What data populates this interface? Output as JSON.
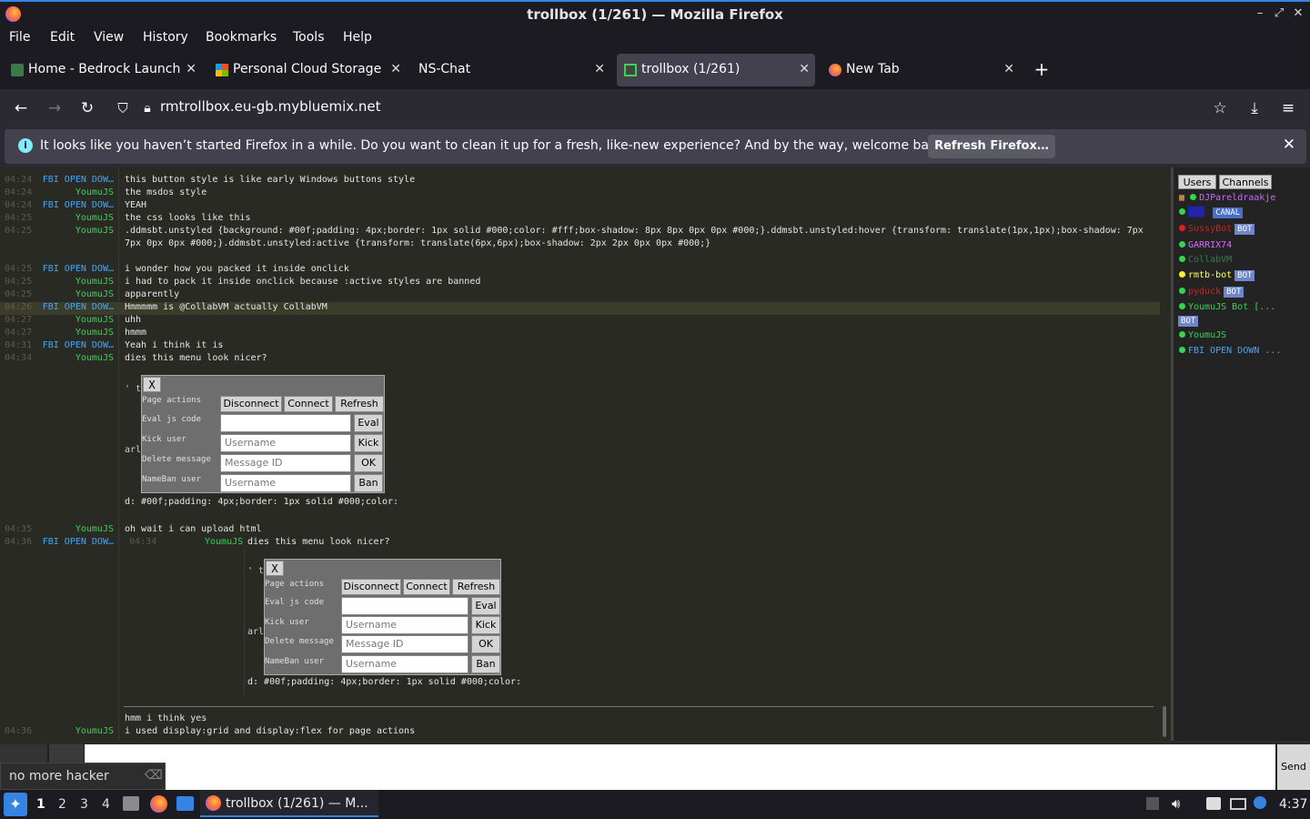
{
  "window": {
    "title": "trollbox (1/261) — Mozilla Firefox"
  },
  "menu": [
    "File",
    "Edit",
    "View",
    "History",
    "Bookmarks",
    "Tools",
    "Help"
  ],
  "tabs": [
    {
      "label": "Home - Bedrock Launche",
      "active": false
    },
    {
      "label": "Personal Cloud Storage -",
      "active": false
    },
    {
      "label": "NS-Chat",
      "active": false
    },
    {
      "label": "trollbox (1/261)",
      "active": true
    },
    {
      "label": "New Tab",
      "active": false
    }
  ],
  "address": {
    "url": "rmtrollbox.eu-gb.mybluemix.net"
  },
  "notification": {
    "message": "It looks like you haven’t started Firefox in a while. Do you want to clean it up for a fresh, like-new experience? And by the way, welcome back!",
    "button": "Refresh Firefox…"
  },
  "chat": {
    "messages": [
      {
        "time": "04:24",
        "user": "FBI OPEN DOW…",
        "text": "this button style is like early Windows buttons style",
        "color": "blue"
      },
      {
        "time": "04:24",
        "user": "YoumuJS",
        "text": "the msdos style",
        "color": "green"
      },
      {
        "time": "04:24",
        "user": "FBI OPEN DOW…",
        "text": "YEAH",
        "color": "blue"
      },
      {
        "time": "04:25",
        "user": "YoumuJS",
        "text": "the css looks like this",
        "color": "green"
      },
      {
        "time": "04:25",
        "user": "YoumuJS",
        "text": ".ddmsbt.unstyled {background: #00f;padding: 4px;border: 1px solid #000;color: #fff;box-shadow: 8px 8px 0px 0px #000;}.ddmsbt.unstyled:hover {transform: translate(1px,1px);box-shadow: 7px",
        "color": "green"
      },
      {
        "time": "",
        "user": "",
        "text": "7px 0px 0px #000;}.ddmsbt.unstyled:active {transform: translate(6px,6px);box-shadow: 2px 2px 0px 0px #000;}",
        "color": "green"
      },
      {
        "time": "04:25",
        "user": "FBI OPEN DOW…",
        "text": "i wonder how you packed it inside onclick",
        "color": "blue"
      },
      {
        "time": "04:25",
        "user": "YoumuJS",
        "text": "i had to pack it inside onclick because :active styles are banned",
        "color": "green"
      },
      {
        "time": "04:25",
        "user": "YoumuJS",
        "text": "apparently",
        "color": "green"
      },
      {
        "time": "04:26",
        "user": "FBI OPEN DOW…",
        "text": "Hmmmmm is @CollabVM actually CollabVM",
        "color": "blue"
      },
      {
        "time": "04:27",
        "user": "YoumuJS",
        "text": "uhh",
        "color": "green"
      },
      {
        "time": "04:27",
        "user": "YoumuJS",
        "text": "hmmm",
        "color": "green"
      },
      {
        "time": "04:31",
        "user": "FBI OPEN DOW…",
        "text": "Yeah i think it is",
        "color": "blue"
      },
      {
        "time": "04:34",
        "user": "YoumuJS",
        "text": "dies this menu look nicer?",
        "color": "green"
      },
      {
        "time": "04:35",
        "user": "YoumuJS",
        "text": "oh wait i can upload html",
        "color": "green"
      },
      {
        "time": "04:36",
        "user": "FBI OPEN DOW…",
        "text": "",
        "color": "blue"
      },
      {
        "time": "",
        "user": "",
        "text": "hmm i think yes",
        "color": "green"
      },
      {
        "time": "04:36",
        "user": "YoumuJS",
        "text": "i used display:grid and display:flex for page actions",
        "color": "green"
      }
    ],
    "quote": {
      "time": "04:34",
      "user": "YoumuJS",
      "text": "dies this menu look nicer?"
    },
    "css_fragment": "d: #00f;padding: 4px;border: 1px solid #000;color:",
    "partial_te": "' te",
    "partial_arl": "arl"
  },
  "panel": {
    "close": "X",
    "labels": [
      "Page actions",
      "Eval js code",
      "Kick user",
      "Delete message",
      "NameBan user"
    ],
    "buttons": [
      "Disconnect",
      "Connect",
      "Refresh"
    ],
    "eval": "Eval",
    "kick": "Kick",
    "ok": "OK",
    "ban": "Ban",
    "ph_username": "Username",
    "ph_message_id": "Message ID"
  },
  "sidebar": {
    "tabs": [
      "Users",
      "Channels"
    ],
    "users": [
      {
        "name": "DJPareldraakje",
        "color": "#cc66ff",
        "bot": false
      },
      {
        "name": "",
        "color": "#2222aa",
        "bot": false,
        "badge": "CANAL"
      },
      {
        "name": "SussyBot",
        "color": "#cc2222",
        "bot": true
      },
      {
        "name": "GARRIX74",
        "color": "#dd66ff",
        "bot": false
      },
      {
        "name": "CollabVM",
        "color": "#3a7a4a",
        "bot": false
      },
      {
        "name": "rmtb-bot",
        "color": "#ffff66",
        "bot": true
      },
      {
        "name": "pyduck",
        "color": "#cc2222",
        "bot": true
      },
      {
        "name": "YoumuJS Bot [...",
        "color": "#39d353",
        "bot": true
      },
      {
        "name": "YoumuJS",
        "color": "#39d353",
        "bot": false
      },
      {
        "name": "FBI OPEN DOWN ...",
        "color": "#3ea8ff",
        "bot": false
      }
    ],
    "bot_label": "BOT"
  },
  "input": {
    "send": "Send",
    "osd": "no more hacker"
  },
  "taskbar": {
    "workspaces": [
      "1",
      "2",
      "3",
      "4"
    ],
    "window": "trollbox (1/261) — M...",
    "clock": "4:37"
  }
}
